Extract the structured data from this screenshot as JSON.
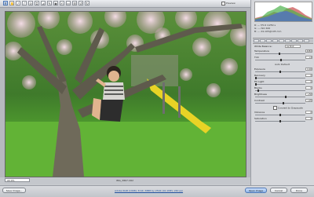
{
  "toolbar": {
    "tools": [
      {
        "name": "zoom-tool-icon",
        "glyph": "⚲"
      },
      {
        "name": "hand-tool-icon",
        "glyph": "✋"
      },
      {
        "name": "white-balance-tool-icon",
        "glyph": "∕"
      },
      {
        "name": "color-sampler-tool-icon",
        "glyph": "⁄"
      },
      {
        "name": "targeted-adjustment-tool-icon",
        "glyph": "⊙"
      },
      {
        "name": "crop-tool-icon",
        "glyph": "⌗"
      },
      {
        "name": "straighten-tool-icon",
        "glyph": "⊿"
      },
      {
        "name": "spot-removal-tool-icon",
        "glyph": "✎"
      },
      {
        "name": "red-eye-tool-icon",
        "glyph": "◉"
      },
      {
        "name": "adjustment-brush-icon",
        "glyph": "✍"
      },
      {
        "name": "graduated-filter-icon",
        "glyph": "▭"
      },
      {
        "name": "preferences-icon",
        "glyph": "☰"
      },
      {
        "name": "rotate-left-icon",
        "glyph": "↺"
      },
      {
        "name": "rotate-right-icon",
        "glyph": "↻"
      }
    ],
    "preview_label": "Preview"
  },
  "status": {
    "zoom": "22.4%",
    "filename": "IMG_3867.CR2"
  },
  "panel": {
    "readout": [
      "R: ---   f/5.6   1/250 s",
      "G: ---   ISO 400",
      "B: ---   24-105@105 mm"
    ],
    "white_balance": {
      "label": "White Balance:",
      "value": "As Shot"
    },
    "temperature": {
      "label": "Temperature",
      "value": "4950",
      "level": 0.48
    },
    "tint": {
      "label": "Tint",
      "value": "+4",
      "level": 0.52
    },
    "auto_default": "Auto   Default",
    "sliders": [
      {
        "label": "Exposure",
        "value": "0.00",
        "level": 0.5
      },
      {
        "label": "Recovery",
        "value": "0",
        "level": 0.0
      },
      {
        "label": "Fill Light",
        "value": "0",
        "level": 0.0
      },
      {
        "label": "Blacks",
        "value": "5",
        "level": 0.05
      },
      {
        "label": "Brightness",
        "value": "+50",
        "level": 0.62
      },
      {
        "label": "Contrast",
        "value": "+25",
        "level": 0.56
      }
    ],
    "convert_grayscale": "Convert to Grayscale",
    "sliders2": [
      {
        "label": "Vibrance",
        "value": "0",
        "level": 0.5
      },
      {
        "label": "Saturation",
        "value": "0",
        "level": 0.5
      }
    ]
  },
  "footer": {
    "save_label": "Save Image...",
    "workflow_link": "Adobe RGB (1998); 8 bit; 3888 by 2592 (10.1MP); 240 ppi",
    "open_label": "Open Image",
    "cancel_label": "Cancel",
    "done_label": "Done"
  }
}
